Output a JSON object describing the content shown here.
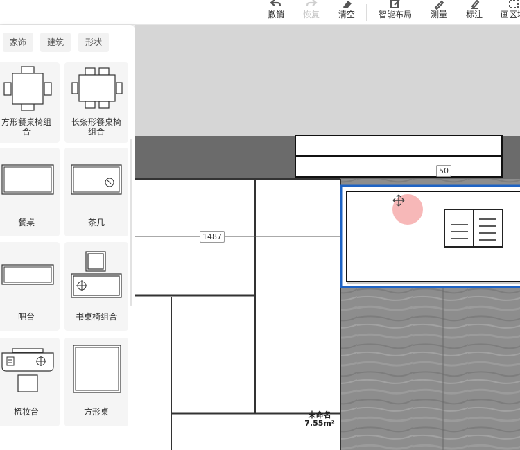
{
  "toolbar": {
    "items": [
      {
        "label": "撤销",
        "icon": "undo-icon",
        "enabled": true
      },
      {
        "label": "恢复",
        "icon": "redo-icon",
        "enabled": false
      },
      {
        "label": "清空",
        "icon": "eraser-icon",
        "enabled": true
      },
      {
        "label": "智能布局",
        "icon": "smart-layout-icon",
        "enabled": true
      },
      {
        "label": "测量",
        "icon": "measure-icon",
        "enabled": true
      },
      {
        "label": "标注",
        "icon": "annotate-icon",
        "enabled": true
      },
      {
        "label": "画区域",
        "icon": "draw-area-icon",
        "enabled": true
      }
    ]
  },
  "panel": {
    "tabs": [
      "家饰",
      "建筑",
      "形状"
    ],
    "items": [
      {
        "name_line1": "方形餐桌椅组",
        "name_line2": "合"
      },
      {
        "name_line1": "长条形餐桌椅",
        "name_line2": "组合"
      },
      {
        "name_line1": "餐桌",
        "name_line2": ""
      },
      {
        "name_line1": "茶几",
        "name_line2": ""
      },
      {
        "name_line1": "吧台",
        "name_line2": ""
      },
      {
        "name_line1": "书桌椅组合",
        "name_line2": ""
      },
      {
        "name_line1": "梳妆台",
        "name_line2": ""
      },
      {
        "name_line1": "方形桌",
        "name_line2": ""
      }
    ]
  },
  "canvas": {
    "dim_top": "50",
    "dim_room": "1487",
    "room_name": "未命名",
    "room_area": "7.55m²",
    "colors": {
      "wall": "#6b6b6b",
      "selection": "#1e63c4",
      "floor": "#8a8a8a",
      "background": "#d6d6d6"
    }
  }
}
